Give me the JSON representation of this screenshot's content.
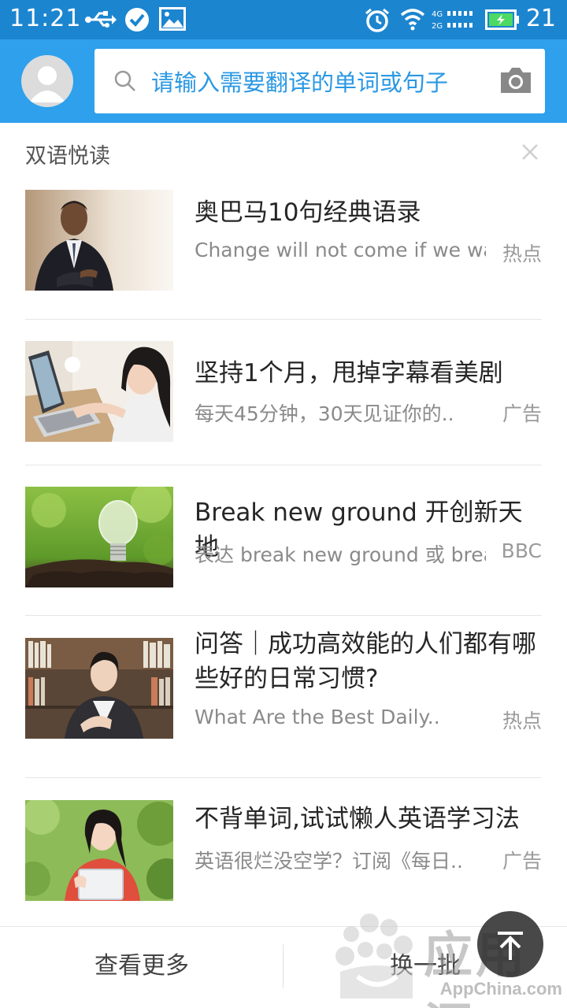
{
  "status_bar": {
    "time": "11:21",
    "battery": "21",
    "icons": [
      "usb-icon",
      "check-circle-icon",
      "image-icon",
      "alarm-icon",
      "wifi-icon",
      "cellular-signal-icon",
      "battery-charging-icon"
    ],
    "network_labels": [
      "4G",
      "2G"
    ]
  },
  "search": {
    "placeholder": "请输入需要翻译的单词或句子"
  },
  "section": {
    "title": "双语悦读"
  },
  "articles": [
    {
      "title": "奥巴马10句经典语录",
      "subtitle": "Change will not come if we wai..",
      "tag": "热点"
    },
    {
      "title": "坚持1个月，甩掉字幕看美剧",
      "subtitle": "每天45分钟，30天见证你的..",
      "tag": "广告"
    },
    {
      "title": "Break new ground 开创新天地",
      "subtitle": "表达 break new ground 或 brea..",
      "tag": "BBC"
    },
    {
      "title": "问答｜成功高效能的人们都有哪些好的日常习惯?",
      "subtitle": "What Are the Best Daily..",
      "tag": "热点"
    },
    {
      "title": "不背单词,试试懒人英语学习法",
      "subtitle": "英语很烂没空学？订阅《每日..",
      "tag": "广告"
    }
  ],
  "bottom_bar": {
    "more_label": "查看更多",
    "refresh_label": "换一批"
  },
  "watermark": {
    "brand": "应用汇",
    "domain": "AppChina.com"
  },
  "colors": {
    "status_bar": "#1c85cf",
    "app_bar": "#2ea0ec",
    "placeholder": "#2a98e3"
  }
}
